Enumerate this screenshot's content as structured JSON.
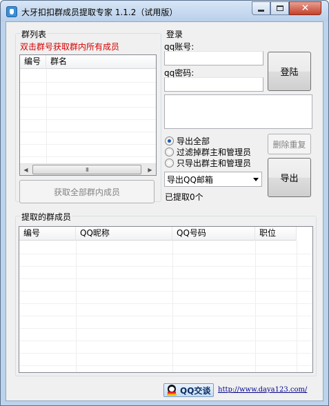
{
  "window": {
    "title": "大牙扣扣群成员提取专家 1.1.2（试用版）",
    "close_glyph": "✕"
  },
  "group_list": {
    "label": "群列表",
    "hint": "双击群号获取群内所有成员",
    "columns": [
      "编号",
      "群名"
    ],
    "scroll_left": "◀",
    "scroll_right": "▶",
    "scroll_thumb": "III",
    "fetch_button": "获取全部群内成员"
  },
  "login": {
    "label": "登录",
    "account_label": "qq账号:",
    "account_value": "",
    "password_label": "qq密码:",
    "password_value": "",
    "login_button": "登陆",
    "delete_dup_button": "删除重复"
  },
  "export": {
    "options": [
      "导出全部",
      "过滤掉群主和管理员",
      "只导出群主和管理员"
    ],
    "selected_index": 0,
    "format_selected": "导出QQ邮箱",
    "export_button": "导出",
    "status": "已提取0个"
  },
  "members": {
    "label": "提取的群成员",
    "columns": [
      "编号",
      "QQ昵称",
      "QQ号码",
      "职位"
    ]
  },
  "footer": {
    "qq_button": "QQ交谈",
    "url": "http://www.daya123.com/"
  }
}
